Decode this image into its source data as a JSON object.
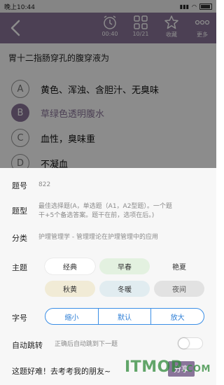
{
  "status_bar": {
    "time": "晚上10:44",
    "battery": "100"
  },
  "header": {
    "timer": "00:40",
    "progress": "10/21",
    "favorite": "收藏",
    "more": "更多"
  },
  "question": {
    "text": "胃十二指肠穿孔的腹穿液为",
    "options": [
      {
        "letter": "A",
        "text": "黄色、浑浊、含胆汁、无臭味"
      },
      {
        "letter": "B",
        "text": "草绿色透明腹水"
      },
      {
        "letter": "C",
        "text": "血性，臭味重"
      },
      {
        "letter": "D",
        "text": "不凝血"
      }
    ]
  },
  "settings": {
    "id_label": "题号",
    "id_value": "822",
    "type_label": "题型",
    "type_value_line1": "最佳选择题(A，单选题（A1，A2型题）。一个题",
    "type_value_line2": "干+5个备选答案。题干在前，选项在后。)",
    "category_label": "分类",
    "category_value": "护理管理学 - 管理理论在护理管理中的应用",
    "theme_label": "主题",
    "themes": [
      "经典",
      "早春",
      "艳夏",
      "秋黄",
      "冬暖",
      "夜间"
    ],
    "font_label": "字号",
    "font_sizes": [
      "缩小",
      "默认",
      "放大"
    ],
    "auto_label": "自动跳转",
    "auto_desc": "正确后自动跳到下一题",
    "share_text": "这题好难！去考考我的朋友~",
    "share_button": "分享"
  },
  "watermark": {
    "main": "ITMOP",
    "suffix": ".COM"
  },
  "colors": {
    "accent": "#8a759a",
    "blue": "#3a8ee6"
  }
}
